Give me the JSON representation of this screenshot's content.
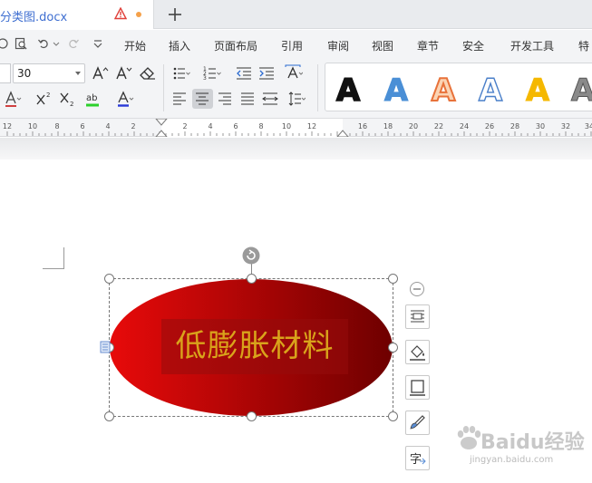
{
  "tab": {
    "title": "分类图.docx"
  },
  "menu": {
    "items": [
      "开始",
      "插入",
      "页面布局",
      "引用",
      "审阅",
      "视图",
      "章节",
      "安全",
      "开发工具",
      "特"
    ]
  },
  "ribbon": {
    "font_size": "30"
  },
  "wordart_styles": [
    {
      "glyph": "A",
      "fill": "#111111",
      "stroke": "#111111"
    },
    {
      "glyph": "A",
      "fill": "#4a8fd6",
      "stroke": "#4a8fd6"
    },
    {
      "glyph": "A",
      "fill": "#fbd4b4",
      "stroke": "#e8723a"
    },
    {
      "glyph": "A",
      "fill": "#ffffff",
      "stroke": "#4a7fc9"
    },
    {
      "glyph": "A",
      "fill": "#f5b800",
      "stroke": "#f5b800"
    },
    {
      "glyph": "A",
      "fill": "#8a8a8a",
      "stroke": "#555555"
    }
  ],
  "ruler": {
    "labels": [
      "12",
      "10",
      "8",
      "6",
      "4",
      "2",
      "2",
      "4",
      "6",
      "8",
      "10",
      "12",
      "16",
      "18",
      "20",
      "22",
      "24",
      "26",
      "28",
      "30",
      "32",
      "34"
    ]
  },
  "shape": {
    "text": "低膨胀材料",
    "gradient_start": "#e80a0a",
    "gradient_end": "#6e0000",
    "text_color": "#d9a31b"
  },
  "side_tools": {
    "text_glyph": "字"
  },
  "watermark": {
    "main": "Baidu经验",
    "sub": "jingyan.baidu.com"
  }
}
